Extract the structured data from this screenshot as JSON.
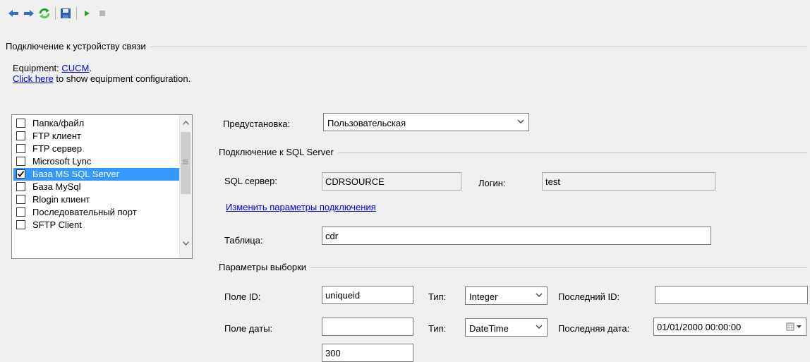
{
  "toolbar": {
    "buttons": [
      {
        "icon": "arrow-left-icon"
      },
      {
        "icon": "arrow-right-icon"
      },
      {
        "icon": "refresh-icon"
      },
      {
        "icon": "save-icon"
      },
      {
        "icon": "play-icon"
      },
      {
        "icon": "stop-icon"
      }
    ]
  },
  "connection_group": {
    "title": "Подключение к устройству связи"
  },
  "equipment": {
    "prefix": "Equipment: ",
    "link": "CUCM",
    "suffix": ".",
    "show_link": "Click here",
    "show_suffix": " to show equipment configuration."
  },
  "source_list": {
    "items": [
      {
        "label": "Папка/файл",
        "checked": false,
        "selected": false
      },
      {
        "label": "FTP клиент",
        "checked": false,
        "selected": false
      },
      {
        "label": "FTP сервер",
        "checked": false,
        "selected": false
      },
      {
        "label": "Microsoft Lync",
        "checked": false,
        "selected": false
      },
      {
        "label": "База MS SQL Server",
        "checked": true,
        "selected": true
      },
      {
        "label": "База MySql",
        "checked": false,
        "selected": false
      },
      {
        "label": "Rlogin клиент",
        "checked": false,
        "selected": false
      },
      {
        "label": "Последовательный порт",
        "checked": false,
        "selected": false
      },
      {
        "label": "SFTP Client",
        "checked": false,
        "selected": false
      }
    ]
  },
  "preset": {
    "label": "Предустановка:",
    "value": "Пользовательская"
  },
  "sql_group": {
    "title": "Подключение к SQL Server",
    "server_label": "SQL сервер:",
    "server_value": "CDRSOURCE",
    "login_label": "Логин:",
    "login_value": "test",
    "change_link": "Изменить параметры подключения",
    "table_label": "Таблица:",
    "table_value": "cdr"
  },
  "selection_group": {
    "title": "Параметры выборки",
    "id_field_label": "Поле ID:",
    "id_field_value": "uniqueid",
    "id_type_label": "Тип:",
    "id_type_value": "Integer",
    "last_id_label": "Последний ID:",
    "last_id_value": "",
    "date_field_label": "Поле даты:",
    "date_field_value": "",
    "date_type_label": "Тип:",
    "date_type_value": "DateTime",
    "last_date_label": "Последняя дата:",
    "last_date_value": "01/01/2000 00:00:00",
    "next_field_value": "300"
  },
  "colors": {
    "selection": "#3399ff",
    "link": "#0000ee",
    "background": "#f0f0f0"
  }
}
